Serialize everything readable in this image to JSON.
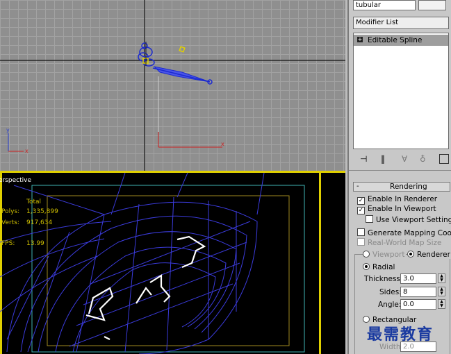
{
  "top_viewport": {
    "label": "",
    "axis_x": "x",
    "axis_y": "y"
  },
  "persp_viewport": {
    "label": "erspective",
    "stats": {
      "header": "Total",
      "polys_label": "Polys:",
      "polys_value": "1,335,899",
      "verts_label": "Verts:",
      "verts_value": "917,634",
      "fps_label": "FPS:",
      "fps_value": "13.99"
    }
  },
  "command_panel": {
    "object_name": "tubular",
    "modifier_list_label": "Modifier List",
    "modifier_stack": [
      {
        "label": "Editable Spline"
      }
    ],
    "rendering_rollout": {
      "title": "Rendering",
      "enable_in_renderer": "Enable In Renderer",
      "enable_in_viewport": "Enable In Viewport",
      "use_viewport_settings": "Use Viewport Settings",
      "generate_mapping": "Generate Mapping Coords.",
      "real_world_map": "Real-World Map Size",
      "viewport_radio": "Viewport",
      "renderer_radio": "Renderer",
      "radial": "Radial",
      "thickness_label": "Thickness:",
      "thickness_value": "3.0",
      "sides_label": "Sides:",
      "sides_value": "8",
      "angle_label": "Angle:",
      "angle_value": "0.0",
      "rectangular": "Rectangular",
      "width_label": "Width:",
      "width_value": "2.0"
    }
  },
  "watermark": {
    "text": "最需教育"
  }
}
